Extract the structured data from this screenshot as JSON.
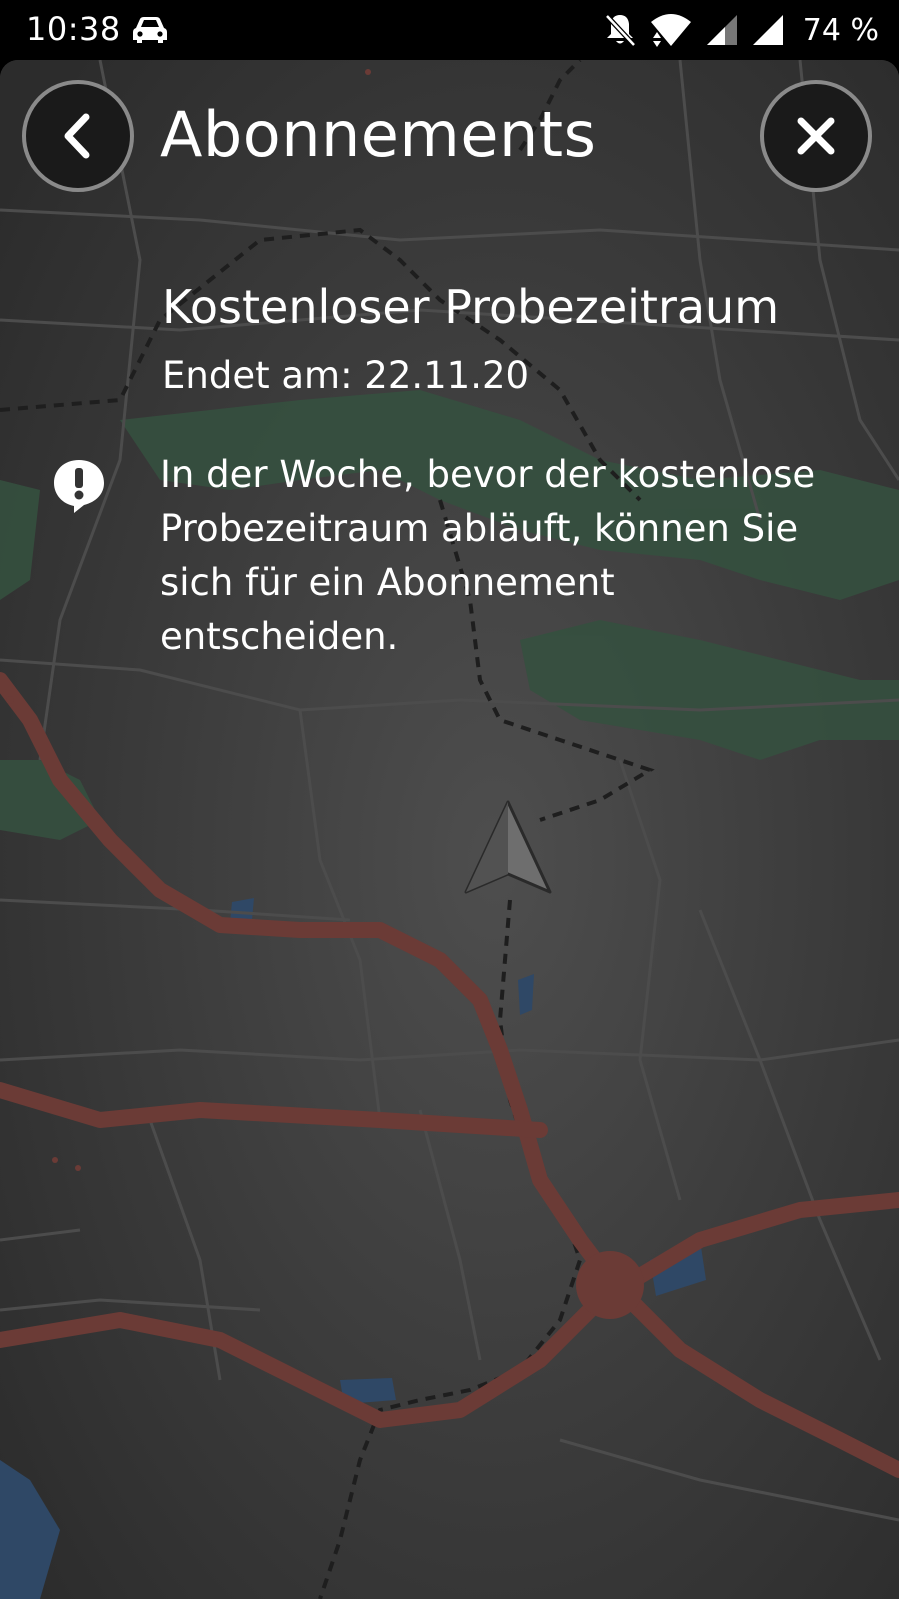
{
  "status_bar": {
    "time": "10:38",
    "car_icon": "car-icon",
    "notifications_icon": "bell-off-icon",
    "wifi_icon": "wifi-icon",
    "signal_icon": "cell-signal-icon",
    "battery_text": "74 %"
  },
  "header": {
    "title": "Abonnements",
    "back_icon": "chevron-left-icon",
    "close_icon": "close-icon"
  },
  "trial": {
    "title": "Kostenloser Probezeitraum",
    "end_date": "Endet am: 22.11.20"
  },
  "info": {
    "icon": "alert-speech-icon",
    "text": "In der Woche, bevor der kostenlose Probezeitraum abläuft, können Sie sich für ein Abonnement entscheiden."
  },
  "map": {
    "position_icon": "navigation-arrow-icon",
    "colors": {
      "background": "#3c3c3c",
      "highway": "#6b3b36",
      "forest": "#35503f",
      "water": "#2f4866",
      "road": "#4a4a4a"
    }
  }
}
